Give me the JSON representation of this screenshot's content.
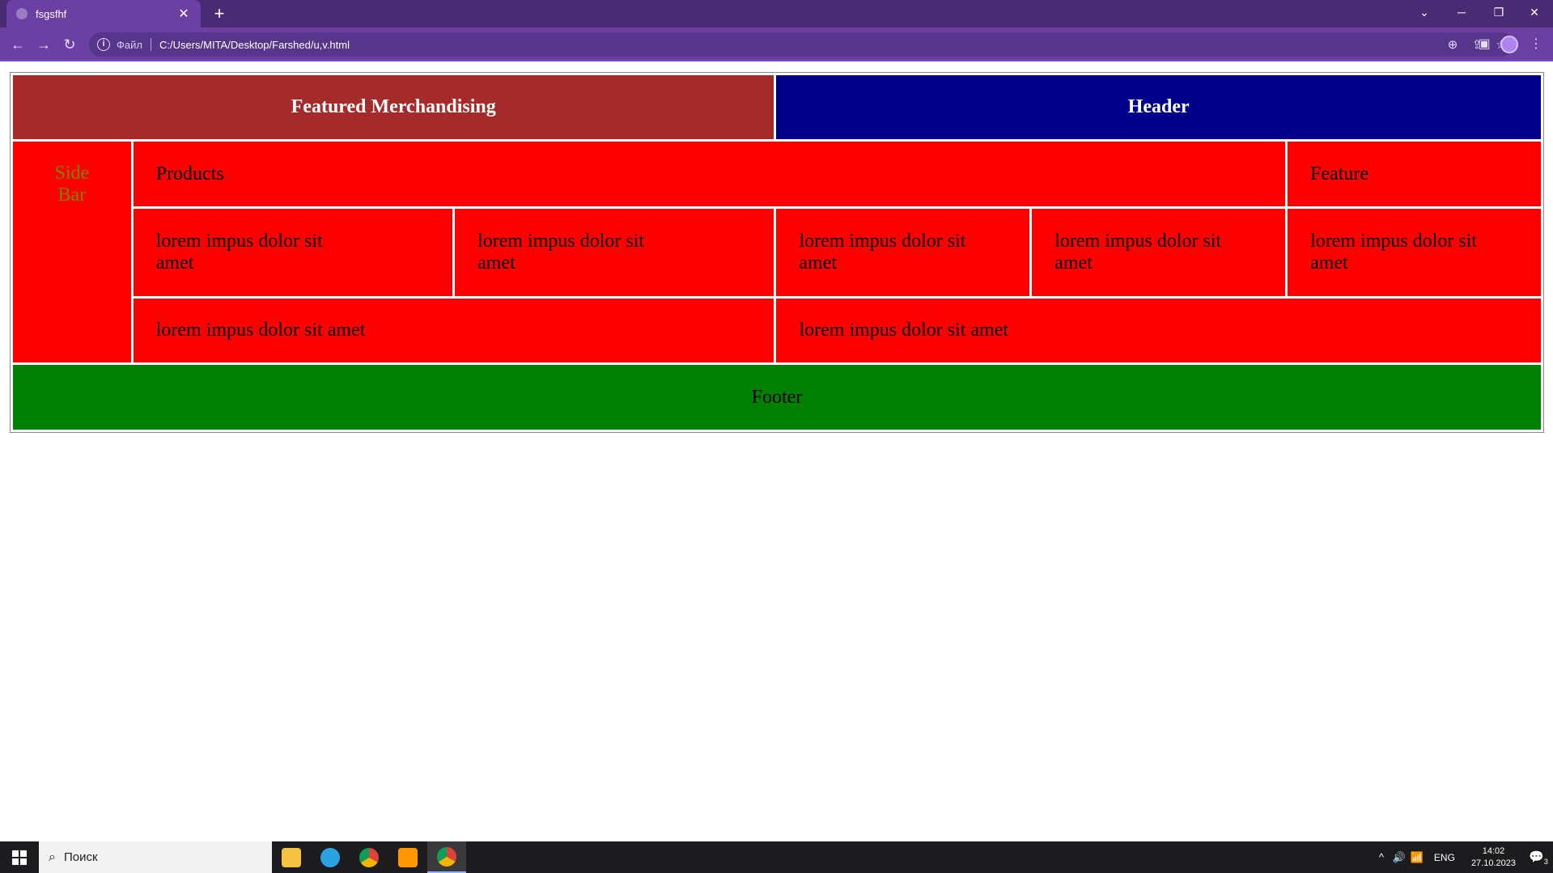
{
  "browser": {
    "tab_title": "fsgsfhf",
    "tab_close": "✕",
    "new_tab": "+",
    "tab_search": "⌄",
    "minimize": "─",
    "restore": "❐",
    "close": "✕",
    "back": "←",
    "forward": "→",
    "reload": "↻",
    "info": "i",
    "scheme_label": "Файл",
    "url": "C:/Users/MITA/Desktop/Farshed/u,v.html",
    "zoom_icon": "⊕",
    "share_icon": "⇪",
    "star_icon": "☆",
    "sidepanel_icon": "▣",
    "menu_icon": "⋮"
  },
  "page": {
    "featured_merchandising": "Featured Merchandising",
    "header": "Header",
    "side_bar": "Side Bar",
    "products": "Products",
    "feature": "Feature",
    "row2": [
      "lorem impus dolor sit amet",
      "lorem impus dolor sit amet",
      "lorem impus dolor sit amet",
      "lorem impus dolor sit amet",
      "lorem impus dolor sit amet"
    ],
    "row3": [
      "lorem impus dolor sit amet",
      "lorem impus dolor sit amet"
    ],
    "footer": "Footer",
    "colors": {
      "merch": "#a52a2a",
      "header": "#00008b",
      "red": "#ff0000",
      "footer": "#008000",
      "sidebar_text": "#808000"
    }
  },
  "taskbar": {
    "search_placeholder": "Поиск",
    "search_icon": "⌕",
    "tray_chevron": "^",
    "tray_volume": "🔊",
    "tray_network": "📶",
    "language": "ENG",
    "time": "14:02",
    "date": "27.10.2023",
    "notification_icon": "💬",
    "notification_count": "3"
  }
}
